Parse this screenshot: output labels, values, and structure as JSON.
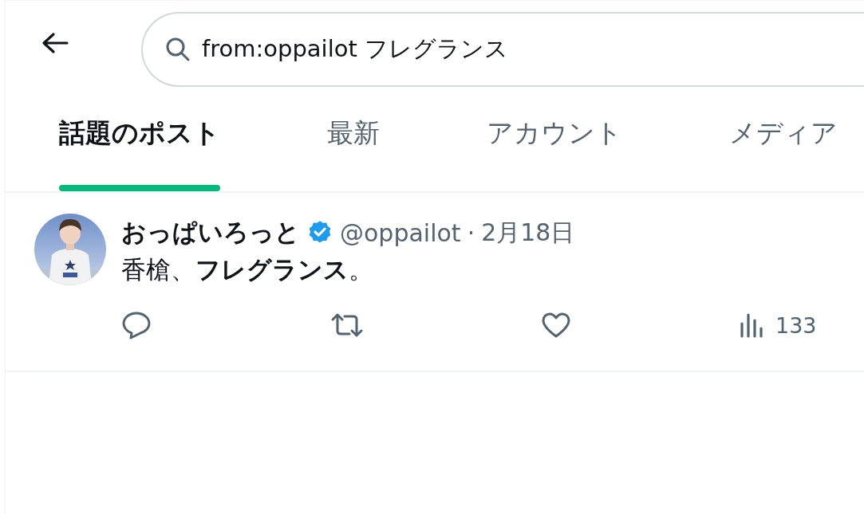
{
  "search": {
    "value": "from:oppailot フレグランス"
  },
  "tabs": [
    {
      "label": "話題のポスト",
      "selected": true
    },
    {
      "label": "最新",
      "selected": false
    },
    {
      "label": "アカウント",
      "selected": false
    },
    {
      "label": "メディア",
      "selected": false
    }
  ],
  "posts": [
    {
      "author": "おっぱいろっと",
      "verified": true,
      "handle": "@oppailot",
      "separator": "·",
      "date": "2月18日",
      "text": "香槍、**フレグランス**。",
      "actions": [
        {
          "kind": "reply"
        },
        {
          "kind": "repost"
        },
        {
          "kind": "like"
        },
        {
          "kind": "views",
          "count": "133"
        }
      ]
    }
  ]
}
